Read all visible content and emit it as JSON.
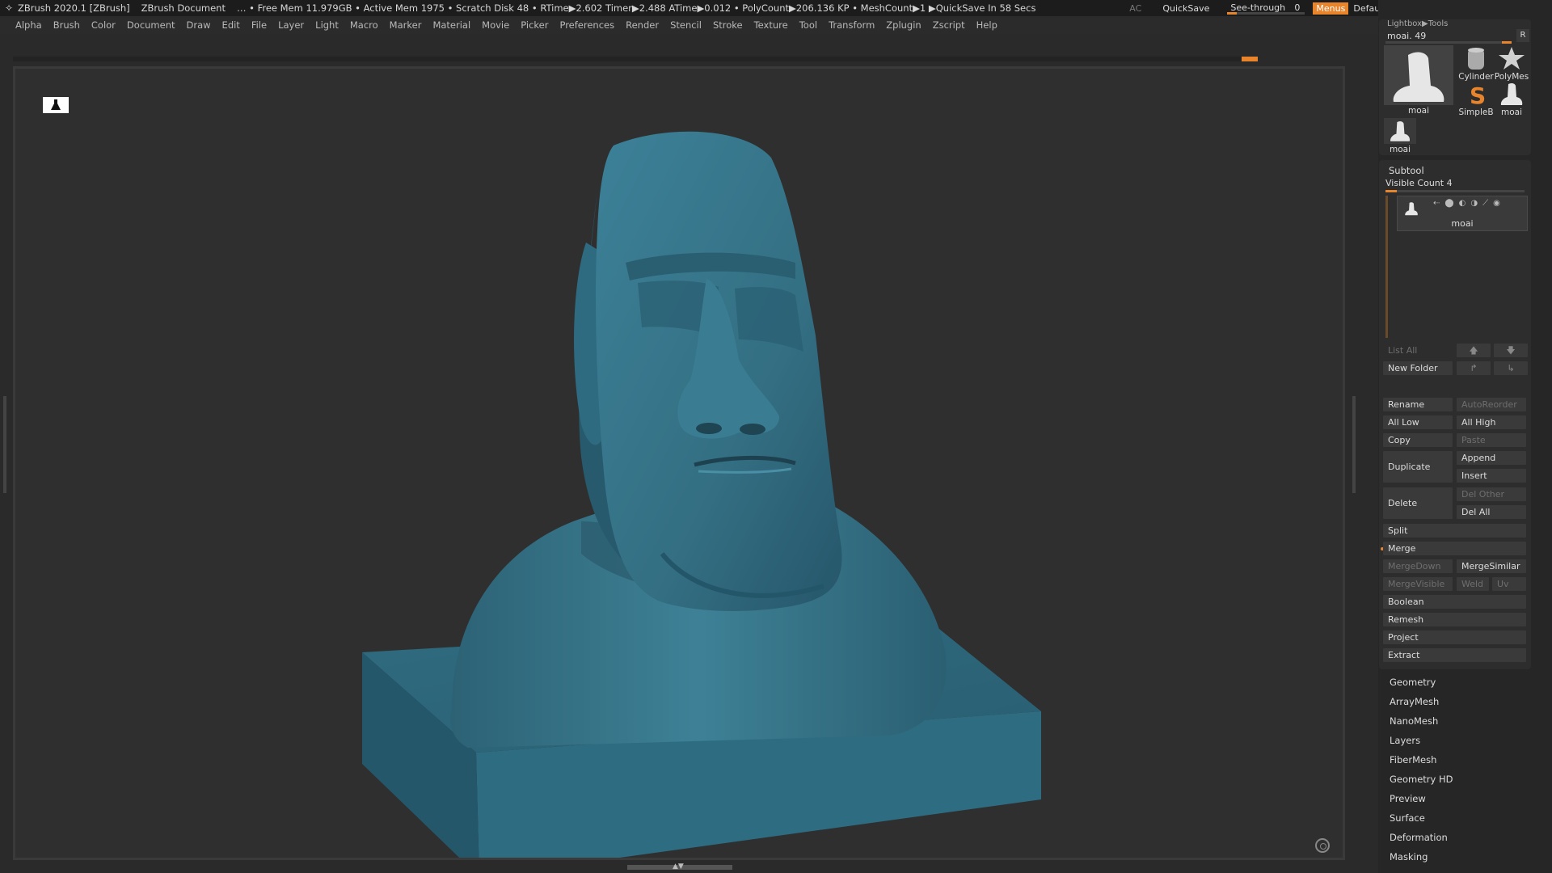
{
  "title_bar": {
    "app_title": "ZBrush 2020.1 [ZBrush]",
    "document": "ZBrush Document",
    "stats": "… • Free Mem 11.979GB • Active Mem 1975 • Scratch Disk 48 •  RTime▶2.602 Timer▶2.488 ATime▶0.012 • PolyCount▶206.136 KP  • MeshCount▶1  ▶QuickSave In 58 Secs",
    "ac_label": "AC",
    "quicksave": "QuickSave",
    "see_through_label": "See-through",
    "see_through_value": "0",
    "menus_label": "Menus",
    "default_zscript": "DefaultZScript",
    "accent_color": "#e8842c"
  },
  "menu_bar": {
    "items": [
      "Alpha",
      "Brush",
      "Color",
      "Document",
      "Draw",
      "Edit",
      "File",
      "Layer",
      "Light",
      "Macro",
      "Marker",
      "Material",
      "Movie",
      "Picker",
      "Preferences",
      "Render",
      "Stencil",
      "Stroke",
      "Texture",
      "Tool",
      "Transform",
      "Zplugin",
      "Zscript",
      "Help"
    ]
  },
  "tool_panel": {
    "breadcrumb": "Lightbox▶Tools",
    "current_tool_slider": "moai. 49",
    "r_button": "R",
    "thumbnails": [
      {
        "label": "moai",
        "icon": "moai-icon"
      },
      {
        "label": "Cylinder",
        "icon": "cylinder-icon"
      },
      {
        "label": "PolyMes",
        "icon": "polymesh-star-icon"
      },
      {
        "label": "SimpleB",
        "icon": "simple-brush-icon"
      },
      {
        "label": "moai",
        "icon": "moai-icon"
      },
      {
        "label": "moai",
        "icon": "moai-icon"
      }
    ]
  },
  "subtool": {
    "header": "Subtool",
    "visible_count": "Visible Count 4",
    "items": [
      {
        "name": "moai"
      }
    ],
    "buttons": {
      "list_all": "List All",
      "new_folder": "New Folder",
      "rename": "Rename",
      "auto_reorder": "AutoReorder",
      "all_low": "All Low",
      "all_high": "All High",
      "copy": "Copy",
      "paste": "Paste",
      "duplicate": "Duplicate",
      "append": "Append",
      "insert": "Insert",
      "delete": "Delete",
      "del_other": "Del Other",
      "del_all": "Del All",
      "split": "Split",
      "merge": "Merge",
      "merge_down": "MergeDown",
      "merge_similar": "MergeSimilar",
      "merge_visible": "MergeVisible",
      "weld": "Weld",
      "uv": "Uv",
      "boolean": "Boolean",
      "remesh": "Remesh",
      "project": "Project",
      "extract": "Extract"
    }
  },
  "tool_submenus": [
    "Geometry",
    "ArrayMesh",
    "NanoMesh",
    "Layers",
    "FiberMesh",
    "Geometry HD",
    "Preview",
    "Surface",
    "Deformation",
    "Masking"
  ],
  "viewport": {
    "model_color": "#2f6f86",
    "background_color": "#2f2f2f"
  }
}
